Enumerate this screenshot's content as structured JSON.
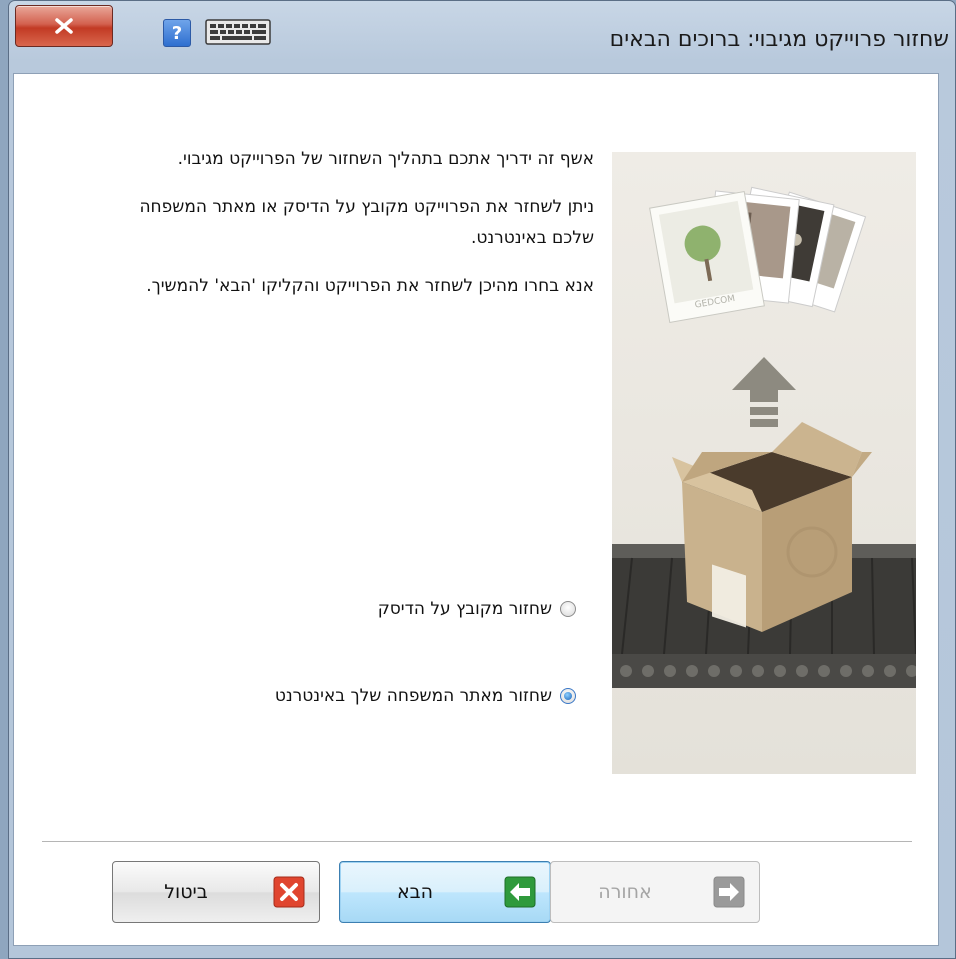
{
  "window": {
    "title": "שחזור פרוייקט מגיבוי: ברוכים הבאים",
    "help_label": "?"
  },
  "intro": {
    "paragraph1": "אשף זה ידריך אתכם בתהליך השחזור של הפרוייקט מגיבוי.",
    "paragraph2": "ניתן לשחזר את הפרוייקט מקובץ על הדיסק או מאתר המשפחה שלכם באינטרנט.",
    "paragraph3": "אנא בחרו מהיכן לשחזר את הפרוייקט והקליקו 'הבא' להמשיך."
  },
  "options": {
    "from_disk": {
      "label": "שחזור מקובץ על הדיסק",
      "checked": false
    },
    "from_website": {
      "label": "שחזור מאתר המשפחה שלך באינטרנט",
      "checked": true
    }
  },
  "buttons": {
    "cancel": "ביטול",
    "next": "הבא",
    "back": "אחורה"
  },
  "illustration": {
    "brand_text": "GEDCOM"
  },
  "colors": {
    "close_red": "#c23a24",
    "next_green": "#2f9a3c",
    "cancel_red": "#e0452f",
    "back_gray": "#9a9a9a",
    "selection_blue": "#3a78c7"
  }
}
